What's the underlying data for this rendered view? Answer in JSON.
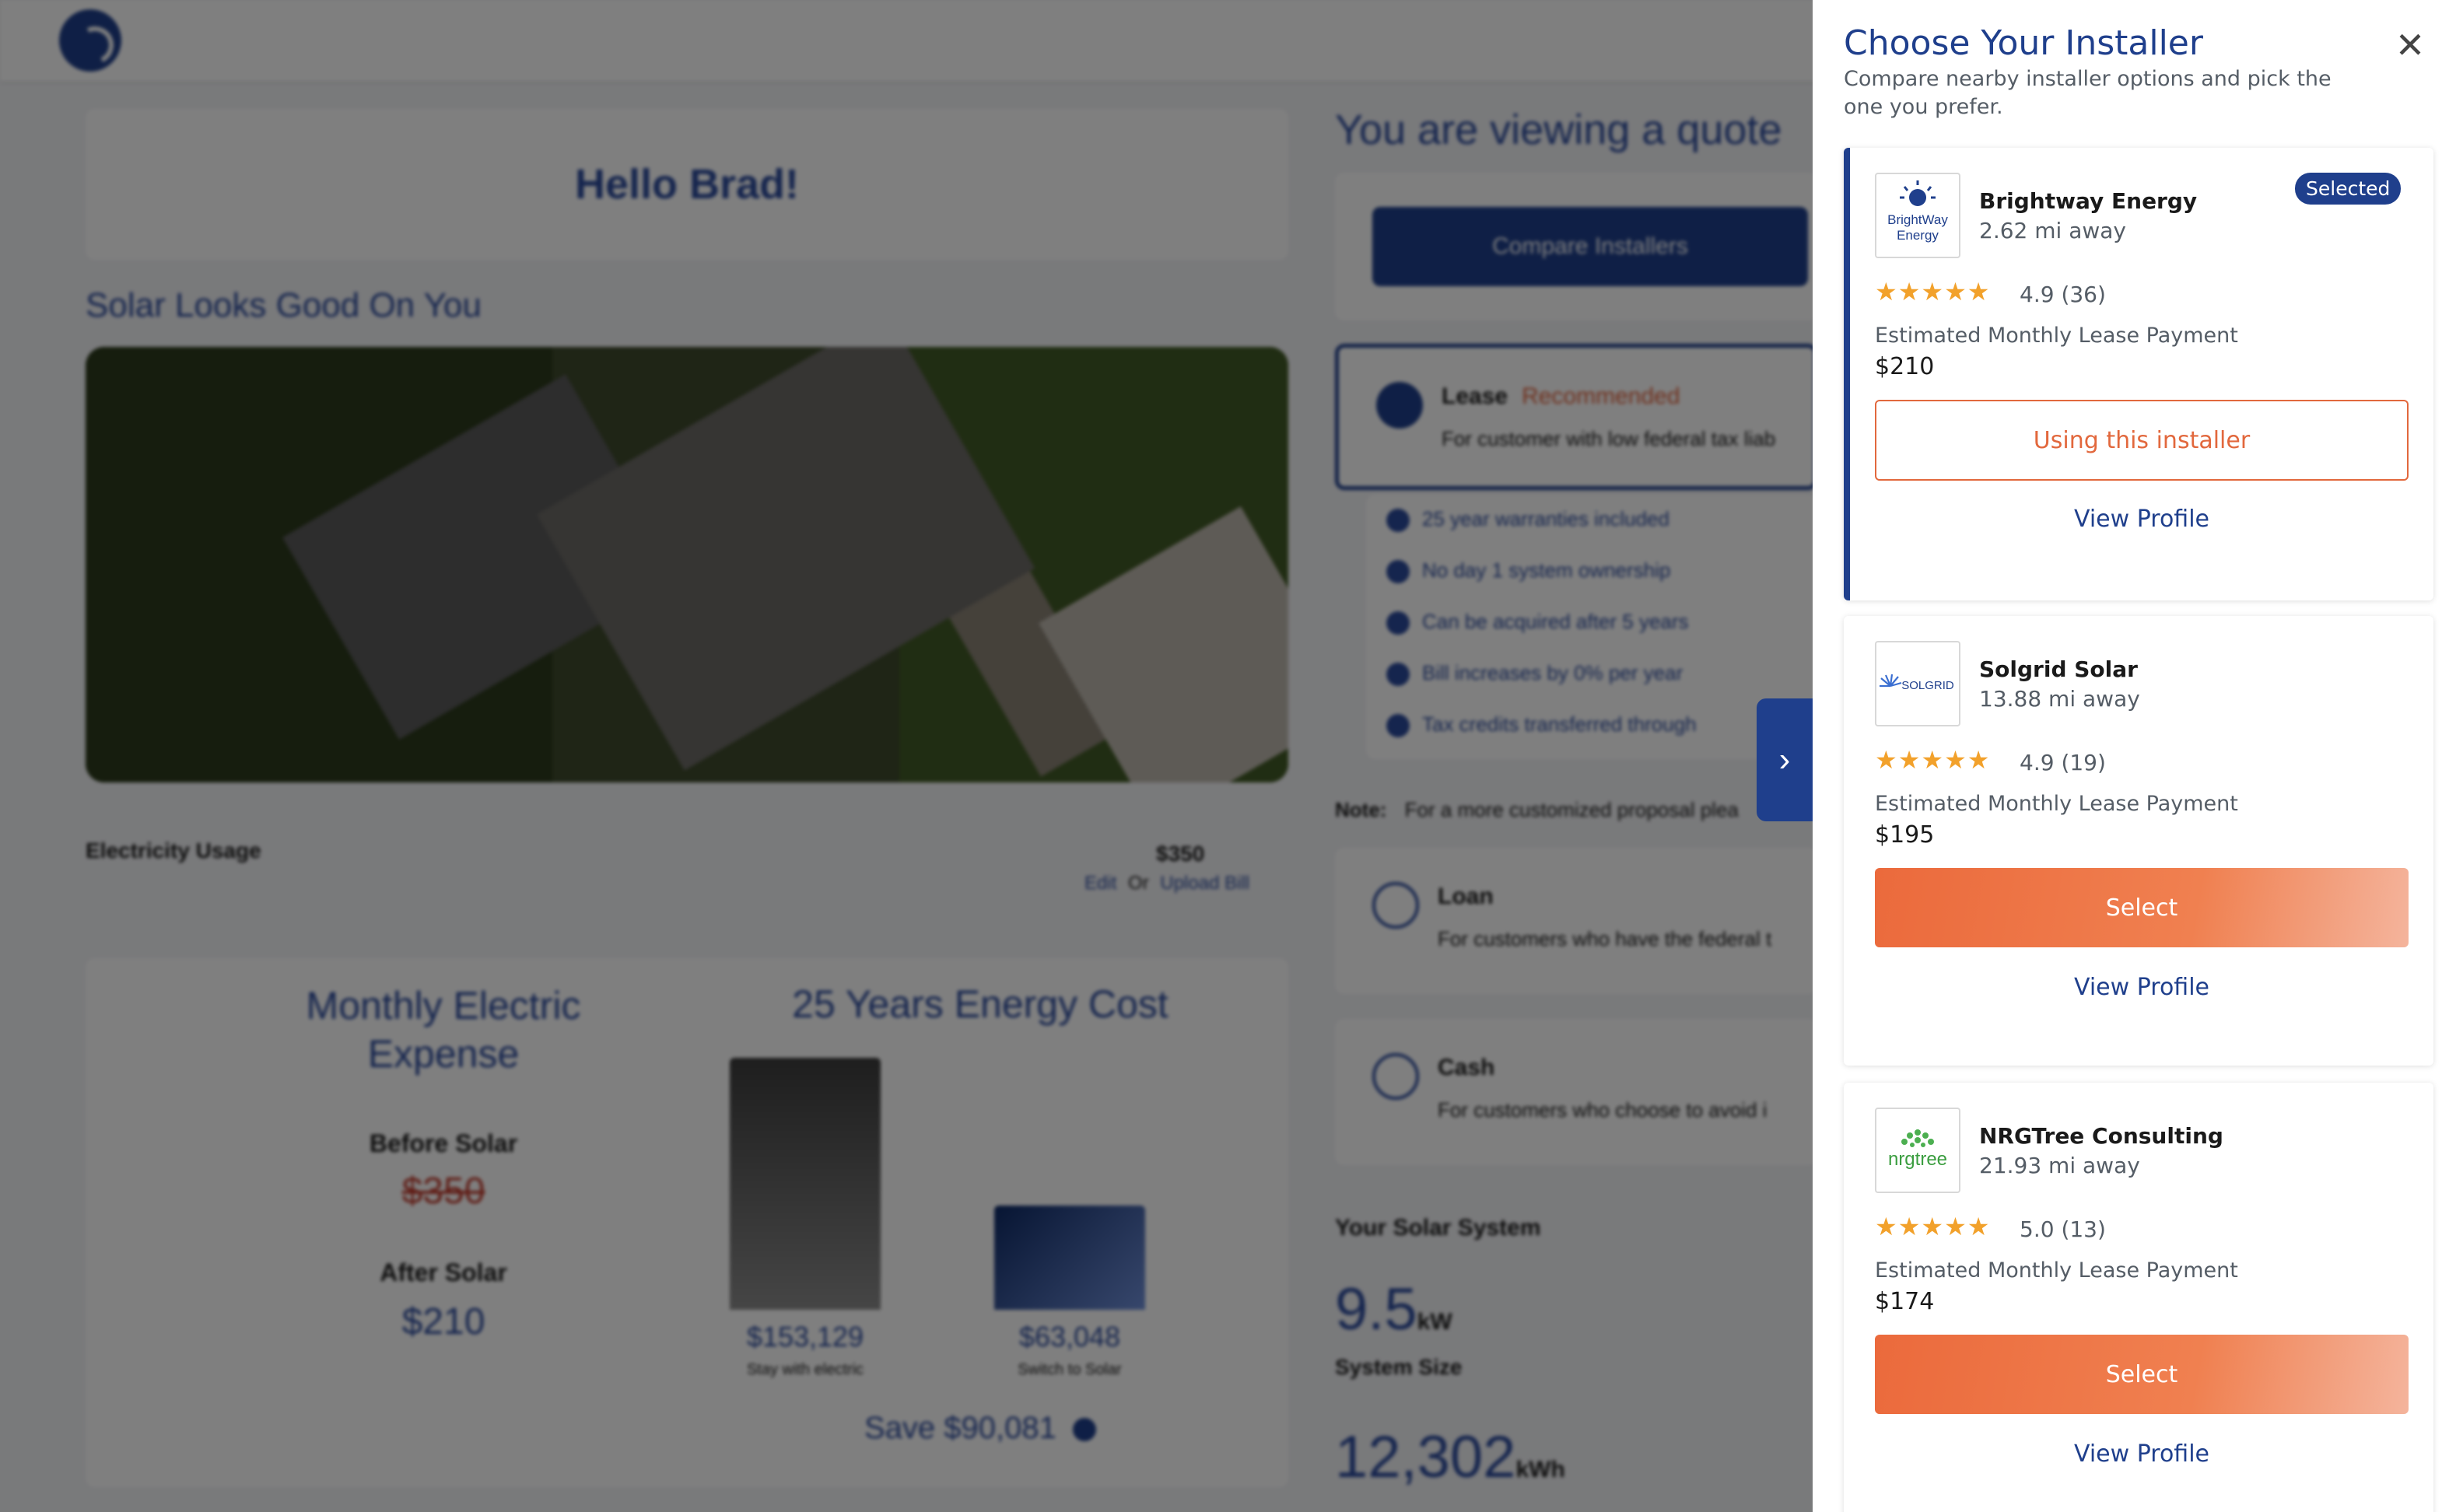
{
  "background": {
    "greeting": "Hello Brad!",
    "section_title": "Solar Looks Good On You",
    "usage_label": "Electricity Usage",
    "usage_value": "$350",
    "edit_link": "Edit",
    "or_text": "Or",
    "upload_link": "Upload Bill",
    "expense_title": "Monthly Electric Expense",
    "before_solar_label": "Before Solar",
    "before_solar_value": "$350",
    "after_solar_label": "After Solar",
    "after_solar_value": "$210",
    "cost_title": "25 Years Energy Cost",
    "bar_stay_value": "$153,129",
    "bar_stay_label": "Stay with electric",
    "bar_switch_value": "$63,048",
    "bar_switch_label": "Switch to Solar",
    "save_text": "Save $90,081",
    "quote_title": "You are viewing a quote",
    "compare_button": "Compare Installers",
    "lease": {
      "title": "Lease",
      "recommended": "Recommended",
      "desc": "For customer with low federal tax liab"
    },
    "features": [
      "25 year warranties included",
      "No day 1 system ownership",
      "Can be acquired after 5 years",
      "Bill increases by 0% per year",
      "Tax credits transferred through"
    ],
    "note_label": "Note:",
    "note_text": "For a more customized proposal plea",
    "loan": {
      "title": "Loan",
      "desc": "For customers who have the federal t"
    },
    "cash": {
      "title": "Cash",
      "desc": "For customers who choose to avoid i"
    },
    "system_title": "Your Solar System",
    "system_size_value": "9.5",
    "system_size_unit": "kW",
    "system_size_label": "System Size",
    "production_value": "12,302",
    "production_unit": "kWh"
  },
  "drawer": {
    "title": "Choose Your Installer",
    "subtitle": "Compare nearby installer options and pick the one you prefer.",
    "close_icon": "close-icon",
    "toggle_icon": "chevron-right-icon",
    "installers": [
      {
        "name": "Brightway Energy",
        "logo_text_1": "BrightWay",
        "logo_text_2": "Energy",
        "distance": "2.62 mi away",
        "badge": "Selected",
        "stars": "★★★★★",
        "rating": "4.9",
        "reviews": "(36)",
        "payment_label": "Estimated Monthly Lease Payment",
        "payment": "$210",
        "action": "Using this installer",
        "view_profile": "View Profile"
      },
      {
        "name": "Solgrid Solar",
        "logo_text_1": "SOLGRID",
        "distance": "13.88 mi away",
        "stars": "★★★★★",
        "rating": "4.9",
        "reviews": "(19)",
        "payment_label": "Estimated Monthly Lease Payment",
        "payment": "$195",
        "action": "Select",
        "view_profile": "View Profile"
      },
      {
        "name": "NRGTree Consulting",
        "logo_text_1": "nrgtree",
        "distance": "21.93 mi away",
        "stars": "★★★★★",
        "rating": "5.0",
        "reviews": "(13)",
        "payment_label": "Estimated Monthly Lease Payment",
        "payment": "$174",
        "action": "Select",
        "view_profile": "View Profile"
      }
    ]
  },
  "colors": {
    "brand_blue": "#1f3f8c",
    "accent_orange": "#eb6a3c",
    "star": "#f2a12b"
  }
}
